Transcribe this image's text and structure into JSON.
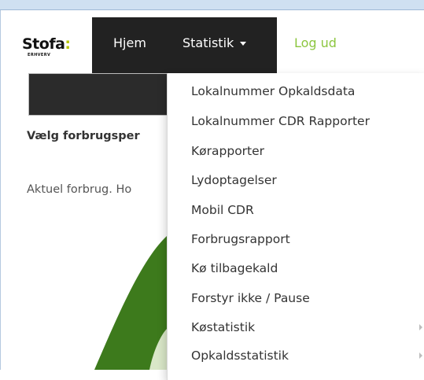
{
  "brand": {
    "name": "Stofa",
    "colon": ":",
    "sub": "ERHVERV",
    "accent": "#b7c400"
  },
  "nav": {
    "home": "Hjem",
    "statistics": "Statistik",
    "logout": "Log ud",
    "logout_color": "#8cc63f"
  },
  "page": {
    "period_label": "Vælg forbrugsper",
    "current_usage": "Aktuel forbrug. Ho"
  },
  "dropdown": {
    "items": [
      {
        "label": "Lokalnummer Opkaldsdata"
      },
      {
        "label": "Lokalnummer CDR Rapporter"
      },
      {
        "label": "Kørapporter"
      },
      {
        "label": "Lydoptagelser"
      },
      {
        "label": "Mobil CDR"
      },
      {
        "label": "Forbrugsrapport"
      },
      {
        "label": "Kø tilbagekald"
      },
      {
        "label": "Forstyr ikke / Pause"
      },
      {
        "label": "Køstatistik",
        "submenu": true
      },
      {
        "label": "Opkaldsstatistik",
        "submenu": true
      }
    ]
  }
}
